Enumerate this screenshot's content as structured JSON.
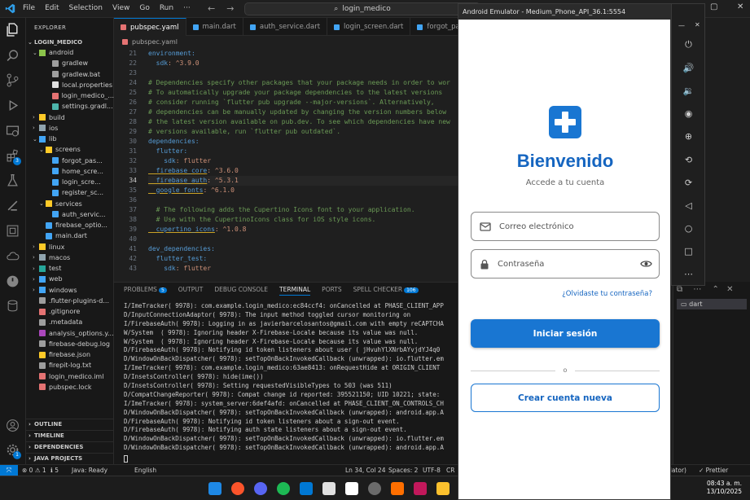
{
  "titlebar": {
    "menu": [
      "File",
      "Edit",
      "Selection",
      "View",
      "Go",
      "Run",
      "···"
    ],
    "search": "login_medico"
  },
  "explorer": {
    "header": "EXPLORER",
    "project": "LOGIN_MEDICO",
    "tree": [
      {
        "label": "android",
        "indent": 1,
        "chev": "⌄",
        "color": "#8bc34a"
      },
      {
        "label": "gradlew",
        "indent": 3,
        "chev": "",
        "color": "#9e9e9e"
      },
      {
        "label": "gradlew.bat",
        "indent": 3,
        "chev": "",
        "color": "#9e9e9e"
      },
      {
        "label": "local.properties",
        "indent": 3,
        "chev": "",
        "color": "#e0e0e0"
      },
      {
        "label": "login_medico_...",
        "indent": 3,
        "chev": "",
        "color": "#e57373"
      },
      {
        "label": "settings.gradl...",
        "indent": 3,
        "chev": "",
        "color": "#4db6ac"
      },
      {
        "label": "build",
        "indent": 1,
        "chev": "›",
        "color": "#ffca28"
      },
      {
        "label": "ios",
        "indent": 1,
        "chev": "›",
        "color": "#90a4ae"
      },
      {
        "label": "lib",
        "indent": 1,
        "chev": "⌄",
        "color": "#42a5f5"
      },
      {
        "label": "screens",
        "indent": 2,
        "chev": "⌄",
        "color": "#ffca28"
      },
      {
        "label": "forgot_pas...",
        "indent": 3,
        "chev": "",
        "color": "#42a5f5"
      },
      {
        "label": "home_scre...",
        "indent": 3,
        "chev": "",
        "color": "#42a5f5"
      },
      {
        "label": "login_scre...",
        "indent": 3,
        "chev": "",
        "color": "#42a5f5"
      },
      {
        "label": "register_sc...",
        "indent": 3,
        "chev": "",
        "color": "#42a5f5"
      },
      {
        "label": "services",
        "indent": 2,
        "chev": "⌄",
        "color": "#ffca28"
      },
      {
        "label": "auth_servic...",
        "indent": 3,
        "chev": "",
        "color": "#42a5f5"
      },
      {
        "label": "firebase_optio...",
        "indent": 2,
        "chev": "",
        "color": "#42a5f5"
      },
      {
        "label": "main.dart",
        "indent": 2,
        "chev": "",
        "color": "#42a5f5"
      },
      {
        "label": "linux",
        "indent": 1,
        "chev": "›",
        "color": "#ffca28"
      },
      {
        "label": "macos",
        "indent": 1,
        "chev": "›",
        "color": "#90a4ae"
      },
      {
        "label": "test",
        "indent": 1,
        "chev": "›",
        "color": "#26a69a"
      },
      {
        "label": "web",
        "indent": 1,
        "chev": "›",
        "color": "#42a5f5"
      },
      {
        "label": "windows",
        "indent": 1,
        "chev": "›",
        "color": "#42a5f5"
      },
      {
        "label": ".flutter-plugins-d...",
        "indent": 1,
        "chev": "",
        "color": "#9e9e9e"
      },
      {
        "label": ".gitignore",
        "indent": 1,
        "chev": "",
        "color": "#e57373"
      },
      {
        "label": ".metadata",
        "indent": 1,
        "chev": "",
        "color": "#9e9e9e"
      },
      {
        "label": "analysis_options.y...",
        "indent": 1,
        "chev": "",
        "color": "#ab47bc"
      },
      {
        "label": "firebase-debug.log",
        "indent": 1,
        "chev": "",
        "color": "#9e9e9e"
      },
      {
        "label": "firebase.json",
        "indent": 1,
        "chev": "",
        "color": "#ffca28"
      },
      {
        "label": "firepit-log.txt",
        "indent": 1,
        "chev": "",
        "color": "#9e9e9e"
      },
      {
        "label": "login_medico.iml",
        "indent": 1,
        "chev": "",
        "color": "#e57373"
      },
      {
        "label": "pubspec.lock",
        "indent": 1,
        "chev": "",
        "color": "#e57373"
      }
    ],
    "sections": [
      "OUTLINE",
      "TIMELINE",
      "DEPENDENCIES",
      "JAVA PROJECTS"
    ]
  },
  "tabs": [
    {
      "label": "pubspec.yaml",
      "active": true,
      "color": "#e57373"
    },
    {
      "label": "main.dart",
      "active": false,
      "color": "#42a5f5"
    },
    {
      "label": "auth_service.dart",
      "active": false,
      "color": "#42a5f5"
    },
    {
      "label": "login_screen.dart",
      "active": false,
      "color": "#42a5f5"
    },
    {
      "label": "forgot_pa",
      "active": false,
      "color": "#42a5f5"
    }
  ],
  "breadcrumb": "pubspec.yaml",
  "editor": {
    "lines": [
      {
        "n": "21",
        "text": "environment:",
        "cls": "key"
      },
      {
        "n": "22",
        "text": "  sdk: ^3.9.0",
        "cls": "kv"
      },
      {
        "n": "23",
        "text": "",
        "cls": ""
      },
      {
        "n": "24",
        "text": "# Dependencies specify other packages that your package needs in order to wor",
        "cls": "comment"
      },
      {
        "n": "25",
        "text": "# To automatically upgrade your package dependencies to the latest versions",
        "cls": "comment"
      },
      {
        "n": "26",
        "text": "# consider running `flutter pub upgrade --major-versions`. Alternatively,",
        "cls": "comment"
      },
      {
        "n": "27",
        "text": "# dependencies can be manually updated by changing the version numbers below",
        "cls": "comment"
      },
      {
        "n": "28",
        "text": "# the latest version available on pub.dev. To see which dependencies have new",
        "cls": "comment"
      },
      {
        "n": "29",
        "text": "# versions available, run `flutter pub outdated`.",
        "cls": "comment"
      },
      {
        "n": "30",
        "text": "dependencies:",
        "cls": "key"
      },
      {
        "n": "31",
        "text": "  flutter:",
        "cls": "key"
      },
      {
        "n": "32",
        "text": "    sdk: flutter",
        "cls": "kv"
      },
      {
        "n": "33",
        "text": "  firebase_core: ^3.6.0",
        "cls": "kvu"
      },
      {
        "n": "34",
        "text": "  firebase_auth: ^5.3.1",
        "cls": "kvu"
      },
      {
        "n": "35",
        "text": "  google_fonts: ^6.1.0",
        "cls": "kvu"
      },
      {
        "n": "36",
        "text": "",
        "cls": ""
      },
      {
        "n": "37",
        "text": "  # The following adds the Cupertino Icons font to your application.",
        "cls": "comment"
      },
      {
        "n": "38",
        "text": "  # Use with the CupertinoIcons class for iOS style icons.",
        "cls": "comment"
      },
      {
        "n": "39",
        "text": "  cupertino_icons: ^1.0.8",
        "cls": "kvu"
      },
      {
        "n": "40",
        "text": "",
        "cls": ""
      },
      {
        "n": "41",
        "text": "dev_dependencies:",
        "cls": "key"
      },
      {
        "n": "42",
        "text": "  flutter_test:",
        "cls": "key"
      },
      {
        "n": "43",
        "text": "    sdk: flutter",
        "cls": "kv"
      }
    ],
    "current_line": "34"
  },
  "panel": {
    "tabs": [
      {
        "label": "PROBLEMS",
        "badge": "5",
        "active": false
      },
      {
        "label": "OUTPUT",
        "badge": "",
        "active": false
      },
      {
        "label": "DEBUG CONSOLE",
        "badge": "",
        "active": false
      },
      {
        "label": "TERMINAL",
        "badge": "",
        "active": true
      },
      {
        "label": "PORTS",
        "badge": "",
        "active": false
      },
      {
        "label": "SPELL CHECKER",
        "badge": "106",
        "active": false
      }
    ],
    "terminal": [
      "I/ImeTracker( 9978): com.example.login_medico:ec84ccf4: onCancelled at PHASE_CLIENT_APP",
      "D/InputConnectionAdaptor( 9978): The input method toggled cursor monitoring on",
      "I/FirebaseAuth( 9978): Logging in as javierbarcelosantos@gmail.com with empty reCAPTCHA",
      "W/System  ( 9978): Ignoring header X-Firebase-Locale because its value was null.",
      "W/System  ( 9978): Ignoring header X-Firebase-Locale because its value was null.",
      "D/FirebaseAuth( 9978): Notifying id token listeners about user ( jHvuhYlXNrbAYvjdYJ4q0",
      "D/WindowOnBackDispatcher( 9978): setTopOnBackInvokedCallback (unwrapped): io.flutter.em",
      "I/ImeTracker( 9978): com.example.login_medico:63ae8413: onRequestHide at ORIGIN_CLIENT",
      "D/InsetsController( 9978): hide(ime())",
      "D/InsetsController( 9978): Setting requestedVisibleTypes to 503 (was 511)",
      "D/CompatChangeReporter( 9978): Compat change id reported: 395521150; UID 10221; state:",
      "I/ImeTracker( 9978): system_server:6def4afd: onCancelled at PHASE_CLIENT_ON_CONTROLS_CH",
      "D/WindowOnBackDispatcher( 9978): setTopOnBackInvokedCallback (unwrapped): android.app.A",
      "D/FirebaseAuth( 9978): Notifying id token listeners about a sign-out event.",
      "D/FirebaseAuth( 9978): Notifying auth state listeners about a sign-out event.",
      "D/WindowOnBackDispatcher( 9978): setTopOnBackInvokedCallback (unwrapped): io.flutter.em",
      "D/WindowOnBackDispatcher( 9978): setTopOnBackInvokedCallback (unwrapped): android.app.A"
    ],
    "right_item": "dart"
  },
  "statusbar": {
    "errors": "⊗ 0 ⚠ 1",
    "warnings": "ℹ 5",
    "java": "Java: Ready",
    "lang_mode": "English",
    "position": "Ln 34, Col 24",
    "spaces": "Spaces: 2",
    "encoding": "UTF-8",
    "eol": "CR",
    "emulator_frag": "ulator)",
    "prettier": "✓ Prettier"
  },
  "taskbar": {
    "time": "08:43 a. m.",
    "date": "13/10/2025"
  },
  "emulator": {
    "title": "Android Emulator - Medium_Phone_API_36.1:5554",
    "welcome": "Bienvenido",
    "subtitle": "Accede a tu cuenta",
    "email_placeholder": "Correo electrónico",
    "password_placeholder": "Contraseña",
    "forgot": "¿Olvidaste tu contraseña?",
    "login_button": "Iniciar sesión",
    "divider_text": "o",
    "register_button": "Crear cuenta nueva",
    "accent": "#1976d2"
  }
}
